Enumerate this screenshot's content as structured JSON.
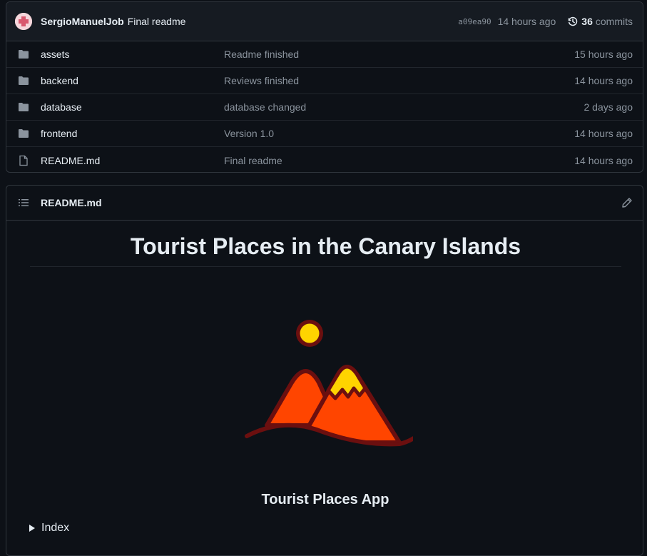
{
  "commit": {
    "author": "SergioManuelJob",
    "message": "Final readme",
    "sha": "a09ea90",
    "time": "14 hours ago",
    "commit_count": "36",
    "commits_label": "commits"
  },
  "files": [
    {
      "name": "assets",
      "type": "folder",
      "message": "Readme finished",
      "date": "15 hours ago"
    },
    {
      "name": "backend",
      "type": "folder",
      "message": "Reviews finished",
      "date": "14 hours ago"
    },
    {
      "name": "database",
      "type": "folder",
      "message": "database changed",
      "date": "2 days ago"
    },
    {
      "name": "frontend",
      "type": "folder",
      "message": "Version 1.0",
      "date": "14 hours ago"
    },
    {
      "name": "README.md",
      "type": "file",
      "message": "Final readme",
      "date": "14 hours ago"
    }
  ],
  "readme": {
    "filename": "README.md",
    "heading": "Tourist Places in the Canary Islands",
    "app_name": "Tourist Places App",
    "details_summary": "Index"
  },
  "icons": {
    "folder": "folder-icon",
    "file": "file-icon",
    "list": "list-unordered-icon",
    "edit": "pencil-icon",
    "history": "history-icon",
    "logo": "mountain-sun-logo"
  },
  "colors": {
    "background": "#0d1117",
    "header_bg": "#161b22",
    "border": "#30363d",
    "muted_text": "#8b949e",
    "text": "#e6edf3",
    "folder_icon": "#8b949e",
    "mountain_orange": "#ff4500",
    "mountain_outline": "#6b0f0f",
    "sun_yellow": "#ffd400"
  }
}
